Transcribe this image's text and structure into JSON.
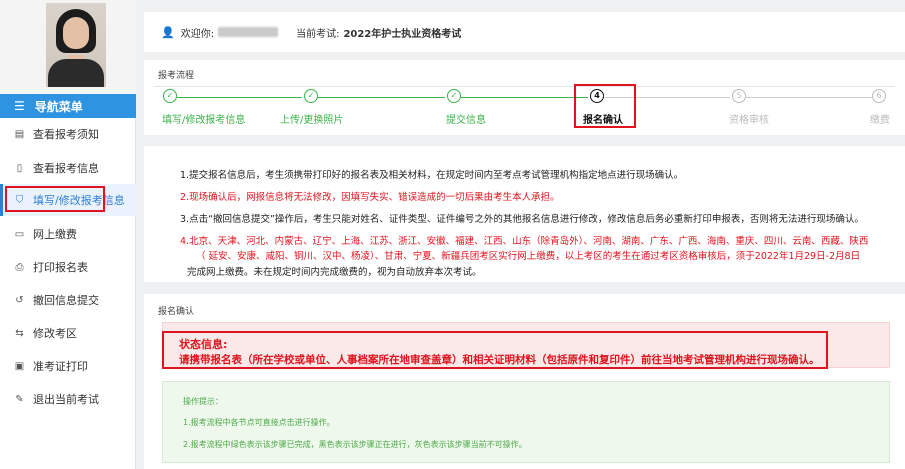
{
  "user": {
    "welcome_label": "欢迎你:",
    "current_exam_label": "当前考试:",
    "current_exam": "2022年护士执业资格考试"
  },
  "nav": {
    "header": "导航菜单",
    "items": [
      {
        "label": "查看报考须知",
        "icon": "notice-icon"
      },
      {
        "label": "查看报考信息",
        "icon": "document-icon"
      },
      {
        "label": "填写/修改报考信息",
        "icon": "shield-check-icon"
      },
      {
        "label": "网上缴费",
        "icon": "card-icon"
      },
      {
        "label": "打印报名表",
        "icon": "print-icon"
      },
      {
        "label": "撤回信息提交",
        "icon": "undo-icon"
      },
      {
        "label": "修改考区",
        "icon": "swap-icon"
      },
      {
        "label": "准考证打印",
        "icon": "monitor-icon"
      },
      {
        "label": "退出当前考试",
        "icon": "edit-icon"
      }
    ]
  },
  "flow": {
    "title": "报考流程",
    "steps": [
      {
        "num": "✓",
        "label": "填写/修改报考信息",
        "state": "done"
      },
      {
        "num": "✓",
        "label": "上传/更换照片",
        "state": "done"
      },
      {
        "num": "✓",
        "label": "提交信息",
        "state": "done"
      },
      {
        "num": "4",
        "label": "报名确认",
        "state": "current"
      },
      {
        "num": "5",
        "label": "资格审核",
        "state": "todo"
      },
      {
        "num": "6",
        "label": "缴费",
        "state": "todo"
      }
    ]
  },
  "notices": {
    "n1": "1.提交报名信息后，考生须携带打印好的报名表及相关材料，在规定时间内至考点考试管理机构指定地点进行现场确认。",
    "n2": "2.现场确认后，网报信息将无法修改，因填写失实、错误造成的一切后果由考生本人承担。",
    "n3": "3.点击“撤回信息提交”操作后，考生只能对姓名、证件类型、证件编号之外的其他报名信息进行修改，修改信息后务必重新打印申报表，否则将无法进行现场确认。",
    "n4_line1": "4.北京、天津、河北、内蒙古、辽宁、上海、江苏、浙江、安徽、福建、江西、山东（除青岛外）、河南、湖南、广东、广西、海南、重庆、四川、云南、西藏、陕西",
    "n4_line2": "（ 延安、安康、咸阳、铜川、汉中、杨凌）、甘肃、宁夏、新疆兵团考区实行网上缴费，以上考区的考生在通过考区资格审核后，须于2022年1月29日-2月8日",
    "n4_line3": "完成网上缴费。未在规定时间内完成缴费的，视为自动放弃本次考试。"
  },
  "confirm": {
    "title": "报名确认",
    "status_title": "状态信息:",
    "status_text": "请携带报名表（所在学校或单位、人事档案所在地审查盖章）和相关证明材料（包括原件和复印件）前往当地考试管理机构进行现场确认。"
  },
  "tips": {
    "title": "操作提示：",
    "t1": "1.报考流程中各节点可直接点击进行操作。",
    "t2": "2.报考流程中绿色表示该步骤已完成，黑色表示该步骤正在进行，灰色表示该步骤当前不可操作。"
  },
  "colors": {
    "accent": "#2e93e0",
    "done": "#39b54a",
    "alert": "#e0141e"
  }
}
